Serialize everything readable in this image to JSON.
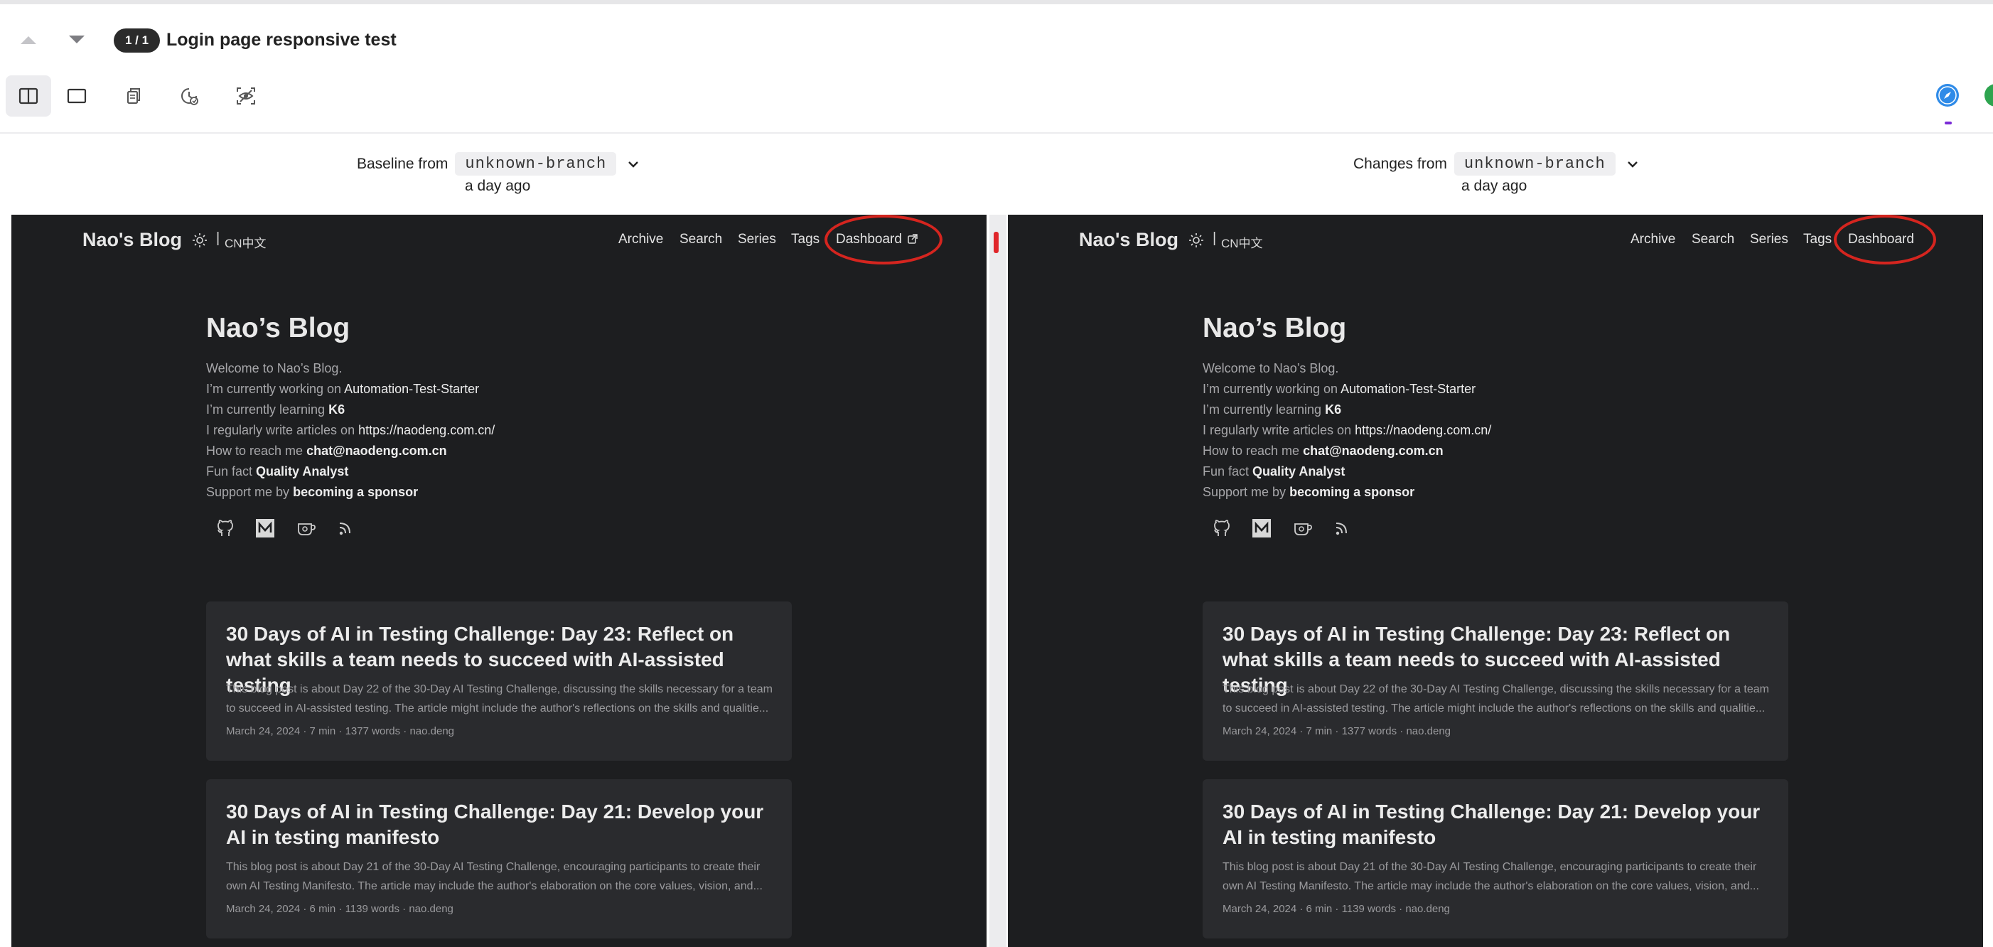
{
  "header": {
    "counter": "1 / 1",
    "title": "Login page responsive test"
  },
  "toolbar": {
    "tools": [
      "split-view-icon",
      "single-view-icon",
      "copy-icon",
      "history-clock-icon",
      "eye-scan-icon"
    ]
  },
  "baseline": {
    "label": "Baseline from",
    "branch": "unknown-branch",
    "time": "a day ago"
  },
  "changes": {
    "label": "Changes from",
    "branch": "unknown-branch",
    "time": "a day ago"
  },
  "site": {
    "brand": "Nao's Blog",
    "separator": "|",
    "lang": "CN中文",
    "menu": [
      "Archive",
      "Search",
      "Series",
      "Tags",
      "Dashboard"
    ],
    "heading": "Nao’s Blog",
    "intro": {
      "welcome": "Welcome to Nao’s Blog.",
      "working_prefix": "I’m currently working on",
      "working_value": "Automation-Test-Starter",
      "learning_prefix": "I’m currently learning",
      "learning_value": "K6",
      "articles_prefix": "I regularly write articles on",
      "articles_value": "https://naodeng.com.cn/",
      "reach_prefix": "How to reach me",
      "reach_value": "chat@naodeng.com.cn",
      "fun_prefix": "Fun fact",
      "fun_value": "Quality Analyst",
      "support_prefix": "Support me by",
      "support_value": "becoming a sponsor"
    },
    "posts": [
      {
        "title": "30 Days of AI in Testing Challenge: Day 23: Reflect on what skills a team needs to succeed with AI-assisted testing",
        "summary": "This blog post is about Day 22 of the 30-Day AI Testing Challenge, discussing the skills necessary for a team to succeed in AI-assisted testing. The article might include the author's reflections on the skills and qualitie...",
        "meta": "March 24, 2024 · 7 min · 1377 words · nao.deng"
      },
      {
        "title": "30 Days of AI in Testing Challenge: Day 21: Develop your AI in testing manifesto",
        "summary": "This blog post is about Day 21 of the 30-Day AI Testing Challenge, encouraging participants to create their own AI Testing Manifesto. The article may include the author's elaboration on the core values, vision, and...",
        "meta": "March 24, 2024 · 6 min · 1139 words · nao.deng"
      }
    ]
  },
  "colors": {
    "annotation": "#d5251f",
    "site_bg": "#1d1e20",
    "card_bg": "#2a2b2e"
  }
}
